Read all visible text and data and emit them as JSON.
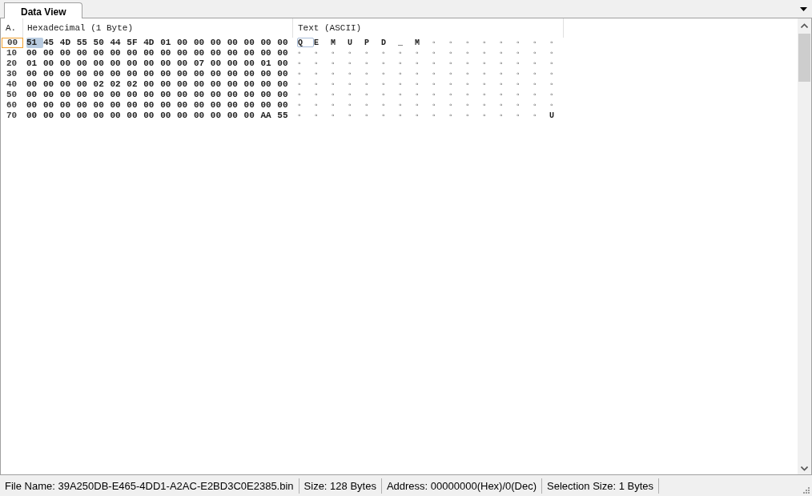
{
  "tabs": [
    {
      "label": "Data View",
      "selected": true
    }
  ],
  "columns": [
    "A.",
    "Hexadecimal (1 Byte)",
    "Text (ASCII)"
  ],
  "rows": [
    {
      "address": "00",
      "selected": true,
      "cells": [
        {
          "hex": "51",
          "text": "Q",
          "selected": true
        },
        {
          "hex": "45",
          "text": "E",
          "selected": false
        },
        {
          "hex": "4D",
          "text": "M",
          "selected": false
        },
        {
          "hex": "55",
          "text": "U",
          "selected": false
        },
        {
          "hex": "50",
          "text": "P",
          "selected": false
        },
        {
          "hex": "44",
          "text": "D",
          "selected": false
        },
        {
          "hex": "5F",
          "text": "_",
          "selected": false
        },
        {
          "hex": "4D",
          "text": "M",
          "selected": false
        },
        {
          "hex": "01",
          "text": "◦",
          "selected": false
        },
        {
          "hex": "00",
          "text": "◦",
          "selected": false
        },
        {
          "hex": "00",
          "text": "◦",
          "selected": false
        },
        {
          "hex": "00",
          "text": "◦",
          "selected": false
        },
        {
          "hex": "00",
          "text": "◦",
          "selected": false
        },
        {
          "hex": "00",
          "text": "◦",
          "selected": false
        },
        {
          "hex": "00",
          "text": "◦",
          "selected": false
        },
        {
          "hex": "00",
          "text": "◦",
          "selected": false
        }
      ]
    },
    {
      "address": "10",
      "selected": false,
      "cells": [
        {
          "hex": "00",
          "text": "◦",
          "selected": false
        },
        {
          "hex": "00",
          "text": "◦",
          "selected": false
        },
        {
          "hex": "00",
          "text": "◦",
          "selected": false
        },
        {
          "hex": "00",
          "text": "◦",
          "selected": false
        },
        {
          "hex": "00",
          "text": "◦",
          "selected": false
        },
        {
          "hex": "00",
          "text": "◦",
          "selected": false
        },
        {
          "hex": "00",
          "text": "◦",
          "selected": false
        },
        {
          "hex": "00",
          "text": "◦",
          "selected": false
        },
        {
          "hex": "00",
          "text": "◦",
          "selected": false
        },
        {
          "hex": "00",
          "text": "◦",
          "selected": false
        },
        {
          "hex": "00",
          "text": "◦",
          "selected": false
        },
        {
          "hex": "00",
          "text": "◦",
          "selected": false
        },
        {
          "hex": "00",
          "text": "◦",
          "selected": false
        },
        {
          "hex": "00",
          "text": "◦",
          "selected": false
        },
        {
          "hex": "00",
          "text": "◦",
          "selected": false
        },
        {
          "hex": "00",
          "text": "◦",
          "selected": false
        }
      ]
    },
    {
      "address": "20",
      "selected": false,
      "cells": [
        {
          "hex": "01",
          "text": "◦",
          "selected": false
        },
        {
          "hex": "00",
          "text": "◦",
          "selected": false
        },
        {
          "hex": "00",
          "text": "◦",
          "selected": false
        },
        {
          "hex": "00",
          "text": "◦",
          "selected": false
        },
        {
          "hex": "00",
          "text": "◦",
          "selected": false
        },
        {
          "hex": "00",
          "text": "◦",
          "selected": false
        },
        {
          "hex": "00",
          "text": "◦",
          "selected": false
        },
        {
          "hex": "00",
          "text": "◦",
          "selected": false
        },
        {
          "hex": "00",
          "text": "◦",
          "selected": false
        },
        {
          "hex": "00",
          "text": "◦",
          "selected": false
        },
        {
          "hex": "07",
          "text": "◦",
          "selected": false
        },
        {
          "hex": "00",
          "text": "◦",
          "selected": false
        },
        {
          "hex": "00",
          "text": "◦",
          "selected": false
        },
        {
          "hex": "00",
          "text": "◦",
          "selected": false
        },
        {
          "hex": "01",
          "text": "◦",
          "selected": false
        },
        {
          "hex": "00",
          "text": "◦",
          "selected": false
        }
      ]
    },
    {
      "address": "30",
      "selected": false,
      "cells": [
        {
          "hex": "00",
          "text": "◦",
          "selected": false
        },
        {
          "hex": "00",
          "text": "◦",
          "selected": false
        },
        {
          "hex": "00",
          "text": "◦",
          "selected": false
        },
        {
          "hex": "00",
          "text": "◦",
          "selected": false
        },
        {
          "hex": "00",
          "text": "◦",
          "selected": false
        },
        {
          "hex": "00",
          "text": "◦",
          "selected": false
        },
        {
          "hex": "00",
          "text": "◦",
          "selected": false
        },
        {
          "hex": "00",
          "text": "◦",
          "selected": false
        },
        {
          "hex": "00",
          "text": "◦",
          "selected": false
        },
        {
          "hex": "00",
          "text": "◦",
          "selected": false
        },
        {
          "hex": "00",
          "text": "◦",
          "selected": false
        },
        {
          "hex": "00",
          "text": "◦",
          "selected": false
        },
        {
          "hex": "00",
          "text": "◦",
          "selected": false
        },
        {
          "hex": "00",
          "text": "◦",
          "selected": false
        },
        {
          "hex": "00",
          "text": "◦",
          "selected": false
        },
        {
          "hex": "00",
          "text": "◦",
          "selected": false
        }
      ]
    },
    {
      "address": "40",
      "selected": false,
      "cells": [
        {
          "hex": "00",
          "text": "◦",
          "selected": false
        },
        {
          "hex": "00",
          "text": "◦",
          "selected": false
        },
        {
          "hex": "00",
          "text": "◦",
          "selected": false
        },
        {
          "hex": "00",
          "text": "◦",
          "selected": false
        },
        {
          "hex": "02",
          "text": "◦",
          "selected": false
        },
        {
          "hex": "02",
          "text": "◦",
          "selected": false
        },
        {
          "hex": "02",
          "text": "◦",
          "selected": false
        },
        {
          "hex": "00",
          "text": "◦",
          "selected": false
        },
        {
          "hex": "00",
          "text": "◦",
          "selected": false
        },
        {
          "hex": "00",
          "text": "◦",
          "selected": false
        },
        {
          "hex": "00",
          "text": "◦",
          "selected": false
        },
        {
          "hex": "00",
          "text": "◦",
          "selected": false
        },
        {
          "hex": "00",
          "text": "◦",
          "selected": false
        },
        {
          "hex": "00",
          "text": "◦",
          "selected": false
        },
        {
          "hex": "00",
          "text": "◦",
          "selected": false
        },
        {
          "hex": "00",
          "text": "◦",
          "selected": false
        }
      ]
    },
    {
      "address": "50",
      "selected": false,
      "cells": [
        {
          "hex": "00",
          "text": "◦",
          "selected": false
        },
        {
          "hex": "00",
          "text": "◦",
          "selected": false
        },
        {
          "hex": "00",
          "text": "◦",
          "selected": false
        },
        {
          "hex": "00",
          "text": "◦",
          "selected": false
        },
        {
          "hex": "00",
          "text": "◦",
          "selected": false
        },
        {
          "hex": "00",
          "text": "◦",
          "selected": false
        },
        {
          "hex": "00",
          "text": "◦",
          "selected": false
        },
        {
          "hex": "00",
          "text": "◦",
          "selected": false
        },
        {
          "hex": "00",
          "text": "◦",
          "selected": false
        },
        {
          "hex": "00",
          "text": "◦",
          "selected": false
        },
        {
          "hex": "00",
          "text": "◦",
          "selected": false
        },
        {
          "hex": "00",
          "text": "◦",
          "selected": false
        },
        {
          "hex": "00",
          "text": "◦",
          "selected": false
        },
        {
          "hex": "00",
          "text": "◦",
          "selected": false
        },
        {
          "hex": "00",
          "text": "◦",
          "selected": false
        },
        {
          "hex": "00",
          "text": "◦",
          "selected": false
        }
      ]
    },
    {
      "address": "60",
      "selected": false,
      "cells": [
        {
          "hex": "00",
          "text": "◦",
          "selected": false
        },
        {
          "hex": "00",
          "text": "◦",
          "selected": false
        },
        {
          "hex": "00",
          "text": "◦",
          "selected": false
        },
        {
          "hex": "00",
          "text": "◦",
          "selected": false
        },
        {
          "hex": "00",
          "text": "◦",
          "selected": false
        },
        {
          "hex": "00",
          "text": "◦",
          "selected": false
        },
        {
          "hex": "00",
          "text": "◦",
          "selected": false
        },
        {
          "hex": "00",
          "text": "◦",
          "selected": false
        },
        {
          "hex": "00",
          "text": "◦",
          "selected": false
        },
        {
          "hex": "00",
          "text": "◦",
          "selected": false
        },
        {
          "hex": "00",
          "text": "◦",
          "selected": false
        },
        {
          "hex": "00",
          "text": "◦",
          "selected": false
        },
        {
          "hex": "00",
          "text": "◦",
          "selected": false
        },
        {
          "hex": "00",
          "text": "◦",
          "selected": false
        },
        {
          "hex": "00",
          "text": "◦",
          "selected": false
        },
        {
          "hex": "00",
          "text": "◦",
          "selected": false
        }
      ]
    },
    {
      "address": "70",
      "selected": false,
      "cells": [
        {
          "hex": "00",
          "text": "◦",
          "selected": false
        },
        {
          "hex": "00",
          "text": "◦",
          "selected": false
        },
        {
          "hex": "00",
          "text": "◦",
          "selected": false
        },
        {
          "hex": "00",
          "text": "◦",
          "selected": false
        },
        {
          "hex": "00",
          "text": "◦",
          "selected": false
        },
        {
          "hex": "00",
          "text": "◦",
          "selected": false
        },
        {
          "hex": "00",
          "text": "◦",
          "selected": false
        },
        {
          "hex": "00",
          "text": "◦",
          "selected": false
        },
        {
          "hex": "00",
          "text": "◦",
          "selected": false
        },
        {
          "hex": "00",
          "text": "◦",
          "selected": false
        },
        {
          "hex": "00",
          "text": "◦",
          "selected": false
        },
        {
          "hex": "00",
          "text": "◦",
          "selected": false
        },
        {
          "hex": "00",
          "text": "◦",
          "selected": false
        },
        {
          "hex": "00",
          "text": "◦",
          "selected": false
        },
        {
          "hex": "AA",
          "text": "◦",
          "selected": false
        },
        {
          "hex": "55",
          "text": "U",
          "selected": false
        }
      ]
    }
  ],
  "status_bar": [
    "File Name: 39A250DB-E465-4DD1-A2AC-E2BD3C0E2385.bin",
    "Size: 128 Bytes",
    "Address: 00000000(Hex)/0(Dec)",
    "Selection Size: 1 Bytes"
  ]
}
